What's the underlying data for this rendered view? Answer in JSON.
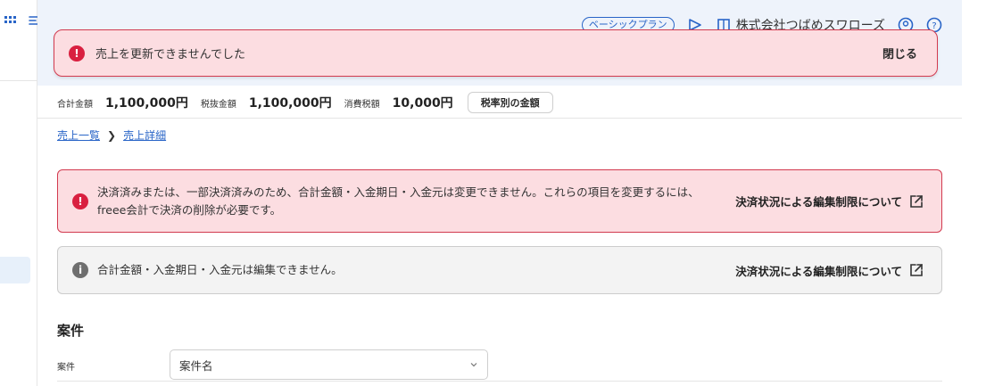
{
  "header": {
    "plan_badge": "ベーシックプラン",
    "company_name": "株式会社つばめスワローズ"
  },
  "toast": {
    "message": "売上を更新できませんでした",
    "close_label": "閉じる"
  },
  "totals": {
    "total_label": "合計金額",
    "total_value": "1,100,000円",
    "pretax_label": "税抜金額",
    "pretax_value": "1,100,000円",
    "tax_label": "消費税額",
    "tax_value": "10,000円",
    "tax_breakdown_button": "税率別の金額"
  },
  "breadcrumb": {
    "items": [
      "売上一覧",
      "売上詳細"
    ]
  },
  "alerts": {
    "error_text": "決済済みまたは、一部決済済みのため、合計金額・入金期日・入金元は変更できません。これらの項目を変更するには、freee会計で決済の削除が必要です。",
    "error_link": "決済状況による編集制限について",
    "info_text": "合計金額・入金期日・入金元は編集できません。",
    "info_link": "決済状況による編集制限について"
  },
  "project": {
    "section_title": "案件",
    "field_label": "案件",
    "select_value": "案件名"
  },
  "colors": {
    "accent": "#2864c7",
    "error": "#d92040",
    "error_bg": "#fcdde1",
    "header_bg": "#eef3fb"
  }
}
